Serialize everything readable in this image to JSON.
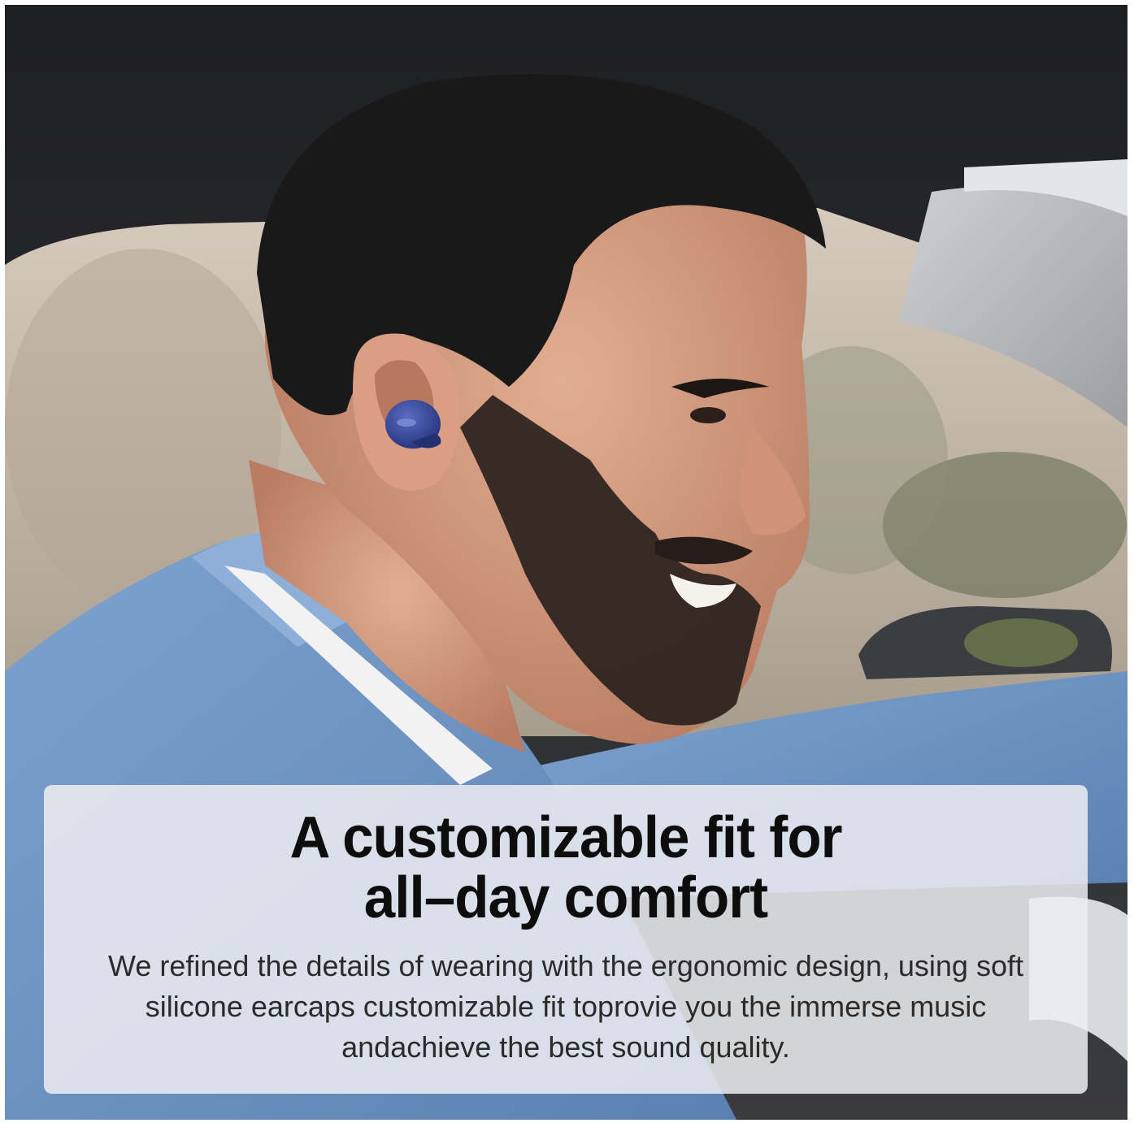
{
  "photo": {
    "subject": "man-with-earbud-in-car",
    "colors": {
      "shirt": "#6f95c4",
      "earbud": "#3a4b9a",
      "hair": "#1a1a1a",
      "skin": "#d39a7e",
      "car_interior": "#2a2b2e",
      "window": "#c9bcae"
    }
  },
  "caption": {
    "headline_line1": "A customizable fit for",
    "headline_line2": "all–day comfort",
    "body": "We refined the details of wearing with the ergonomic design, using soft silicone earcaps customizable fit toprovie you the immerse music andachieve the best sound quality."
  }
}
